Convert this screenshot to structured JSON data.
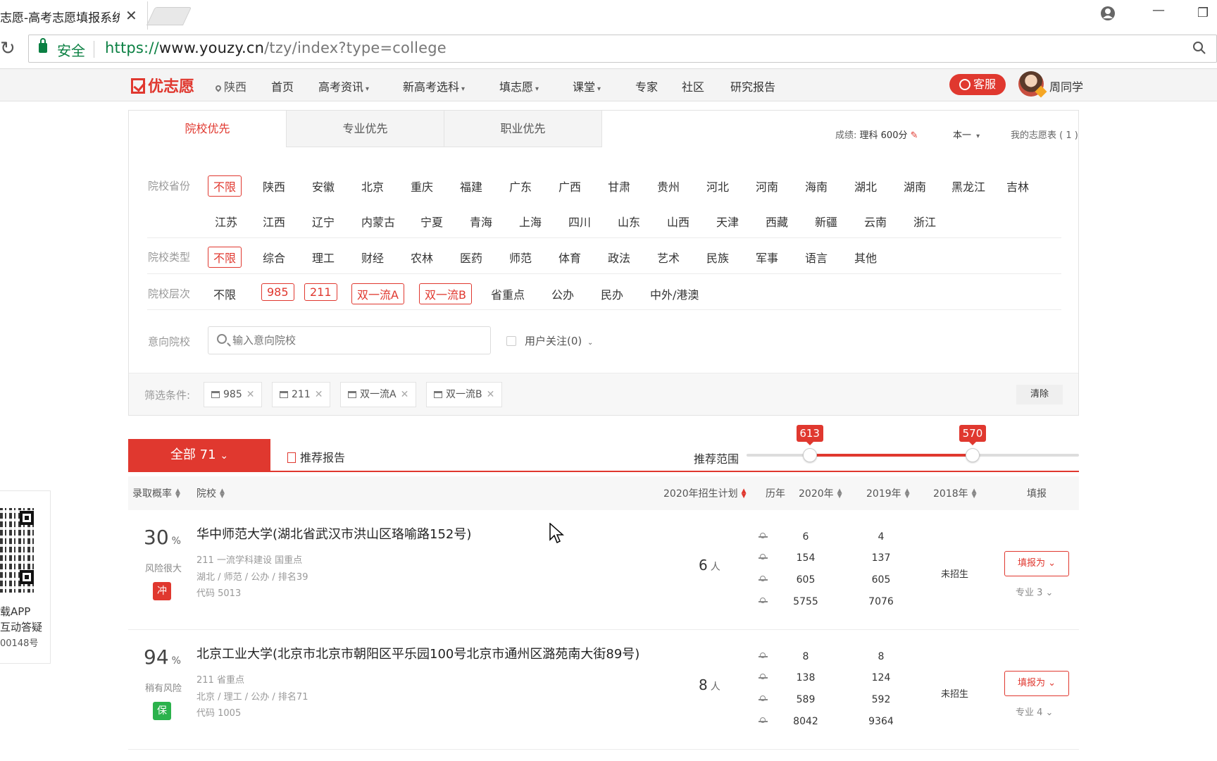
{
  "browser": {
    "tab_title": "志愿-高考志愿填报系统",
    "secure_label": "安全",
    "url_scheme": "https://",
    "url_host": "www.youzy.cn",
    "url_path": "/tzy/index?type=college"
  },
  "header": {
    "logo": "优志愿",
    "location": "陕西",
    "nav": [
      "首页",
      "高考资讯",
      "新高考选科",
      "填志愿",
      "课堂",
      "专家",
      "社区",
      "研究报告"
    ],
    "service": "客服",
    "username": "周同学"
  },
  "panel": {
    "tabs": [
      "院校优先",
      "专业优先",
      "职业优先"
    ],
    "score_label": "成绩:",
    "score_value": "理科 600分",
    "batch": "本一",
    "my_table": "我的志愿表 ( 1 )",
    "province_label": "院校省份",
    "provinces_row1": [
      "不限",
      "陕西",
      "安徽",
      "北京",
      "重庆",
      "福建",
      "广东",
      "广西",
      "甘肃",
      "贵州",
      "河北",
      "河南",
      "海南",
      "湖北",
      "湖南",
      "黑龙江",
      "吉林"
    ],
    "provinces_row2": [
      "江苏",
      "江西",
      "辽宁",
      "内蒙古",
      "宁夏",
      "青海",
      "上海",
      "四川",
      "山东",
      "山西",
      "天津",
      "西藏",
      "新疆",
      "云南",
      "浙江"
    ],
    "type_label": "院校类型",
    "types": [
      "不限",
      "综合",
      "理工",
      "财经",
      "农林",
      "医药",
      "师范",
      "体育",
      "政法",
      "艺术",
      "民族",
      "军事",
      "语言",
      "其他"
    ],
    "level_label": "院校层次",
    "levels": [
      "不限",
      "985",
      "211",
      "双一流A",
      "双一流B",
      "省重点",
      "公办",
      "民办",
      "中外/港澳"
    ],
    "intent_label": "意向院校",
    "search_placeholder": "输入意向院校",
    "follow": "用户关注(0)",
    "cond_label": "筛选条件:",
    "chips": [
      "985",
      "211",
      "双一流A",
      "双一流B"
    ],
    "clear": "清除"
  },
  "results": {
    "all_label": "全部 71",
    "report": "推荐报告",
    "range_label": "推荐范围",
    "range_low": "613",
    "range_high": "570",
    "range_low_pos": 0.19,
    "range_high_pos": 0.68,
    "headers": [
      "录取概率",
      "院校",
      "2020年招生计划",
      "历年",
      "2020年",
      "2019年",
      "2018年",
      "填报"
    ],
    "rows": [
      {
        "prob": "30",
        "risk": "风险很大",
        "badge": "冲",
        "badge_color": "#e0382f",
        "name": "华中师范大学(湖北省武汉市洪山区珞喻路152号)",
        "tags": "211 一流学科建设 国重点",
        "info": "湖北 / 师范 / 公办 / 排名39",
        "code": "代码 5013",
        "plan": "6",
        "y2020": [
          "6",
          "154",
          "605",
          "5755"
        ],
        "y2019": [
          "4",
          "137",
          "605",
          "7076"
        ],
        "y2018": "未招生",
        "action": "填报为",
        "majors": "专业 3"
      },
      {
        "prob": "94",
        "risk": "稍有风险",
        "badge": "保",
        "badge_color": "#2bb24c",
        "name": "北京工业大学(北京市北京市朝阳区平乐园100号北京市通州区潞苑南大街89号)",
        "tags": "211 省重点",
        "info": "北京 / 理工 / 公办 / 排名71",
        "code": "代码 1005",
        "plan": "8",
        "y2020": [
          "8",
          "138",
          "589",
          "8042"
        ],
        "y2019": [
          "8",
          "124",
          "592",
          "9364"
        ],
        "y2018": "未招生",
        "action": "填报为",
        "majors": "专业 4"
      }
    ],
    "unit": "人",
    "pct": "%"
  },
  "promo": {
    "line1": "载APP",
    "line2": "互动答疑",
    "line3": "00148号"
  },
  "colors": {
    "brand": "#e0382f",
    "safe": "#2bb24c",
    "secure": "#0b8043"
  }
}
